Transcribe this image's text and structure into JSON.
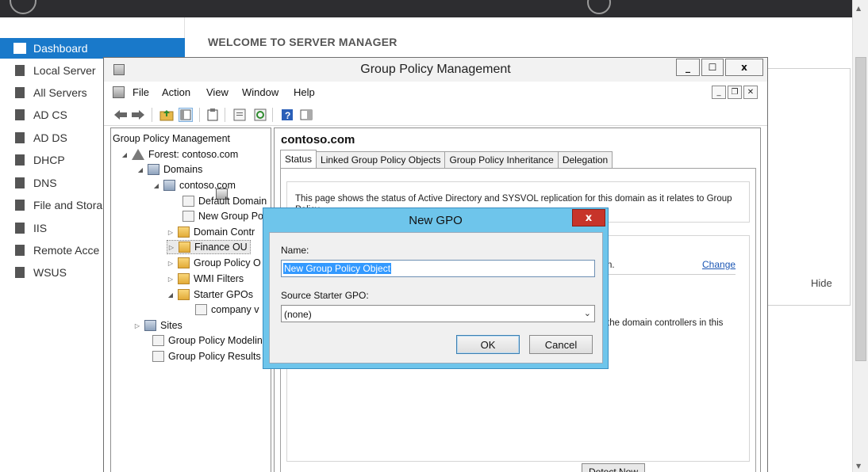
{
  "server_manager": {
    "welcome": "WELCOME TO SERVER MANAGER",
    "hide": "Hide",
    "nav": [
      {
        "label": "Dashboard",
        "icon": "dashboard-icon",
        "active": true
      },
      {
        "label": "Local Server",
        "icon": "server-icon"
      },
      {
        "label": "All Servers",
        "icon": "servers-icon"
      },
      {
        "label": "AD CS",
        "icon": "adcs-icon"
      },
      {
        "label": "AD DS",
        "icon": "adds-icon"
      },
      {
        "label": "DHCP",
        "icon": "dhcp-icon"
      },
      {
        "label": "DNS",
        "icon": "dns-icon"
      },
      {
        "label": "File and Stora",
        "icon": "file-storage-icon"
      },
      {
        "label": "IIS",
        "icon": "iis-icon"
      },
      {
        "label": "Remote Acce",
        "icon": "remote-access-icon"
      },
      {
        "label": "WSUS",
        "icon": "wsus-icon"
      }
    ]
  },
  "gpm": {
    "title": "Group Policy Management",
    "window_buttons": [
      "_",
      "☐",
      "x"
    ],
    "menu": [
      "File",
      "Action",
      "View",
      "Window",
      "Help"
    ],
    "tree": [
      {
        "label": "Group Policy Management",
        "icon": "gpm-icon"
      },
      {
        "label": "Forest: contoso.com",
        "icon": "forest-icon",
        "arrow": "◢"
      },
      {
        "label": "Domains",
        "icon": "domains-icon",
        "arrow": "◢"
      },
      {
        "label": "contoso.com",
        "icon": "domain-icon",
        "arrow": "◢"
      },
      {
        "label": "Default Domain",
        "icon": "gpo-link-icon"
      },
      {
        "label": "New Group Po",
        "icon": "gpo-link-icon"
      },
      {
        "label": "Domain Contr",
        "icon": "ou-icon",
        "arrow": "▷"
      },
      {
        "label": "Finance OU",
        "icon": "ou-icon",
        "arrow": "▷",
        "selected": true
      },
      {
        "label": "Group Policy O",
        "icon": "gpo-folder-icon",
        "arrow": "▷"
      },
      {
        "label": "WMI Filters",
        "icon": "wmi-folder-icon",
        "arrow": "▷"
      },
      {
        "label": "Starter GPOs",
        "icon": "starter-folder-icon",
        "arrow": "◢"
      },
      {
        "label": "company v",
        "icon": "starter-gpo-icon"
      },
      {
        "label": "Sites",
        "icon": "sites-icon",
        "arrow": "▷"
      },
      {
        "label": "Group Policy Modelin",
        "icon": "modeling-icon"
      },
      {
        "label": "Group Policy Results",
        "icon": "results-icon"
      }
    ],
    "domain_title": "contoso.com",
    "tabs": [
      "Status",
      "Linked Group Policy Objects",
      "Group Policy Inheritance",
      "Delegation"
    ],
    "status_text": "This page shows the status of Active Directory and SYSVOL replication for this domain as it relates to Group Policy.",
    "frag_n": "n.",
    "change_link": "Change",
    "frag_dc": "the domain controllers in this",
    "detect_now": "Detect Now"
  },
  "dialog": {
    "title": "New GPO",
    "close": "x",
    "name_label": "Name:",
    "name_value": "New Group Policy Object",
    "source_label": "Source Starter GPO:",
    "source_value": "(none)",
    "ok": "OK",
    "cancel": "Cancel"
  }
}
